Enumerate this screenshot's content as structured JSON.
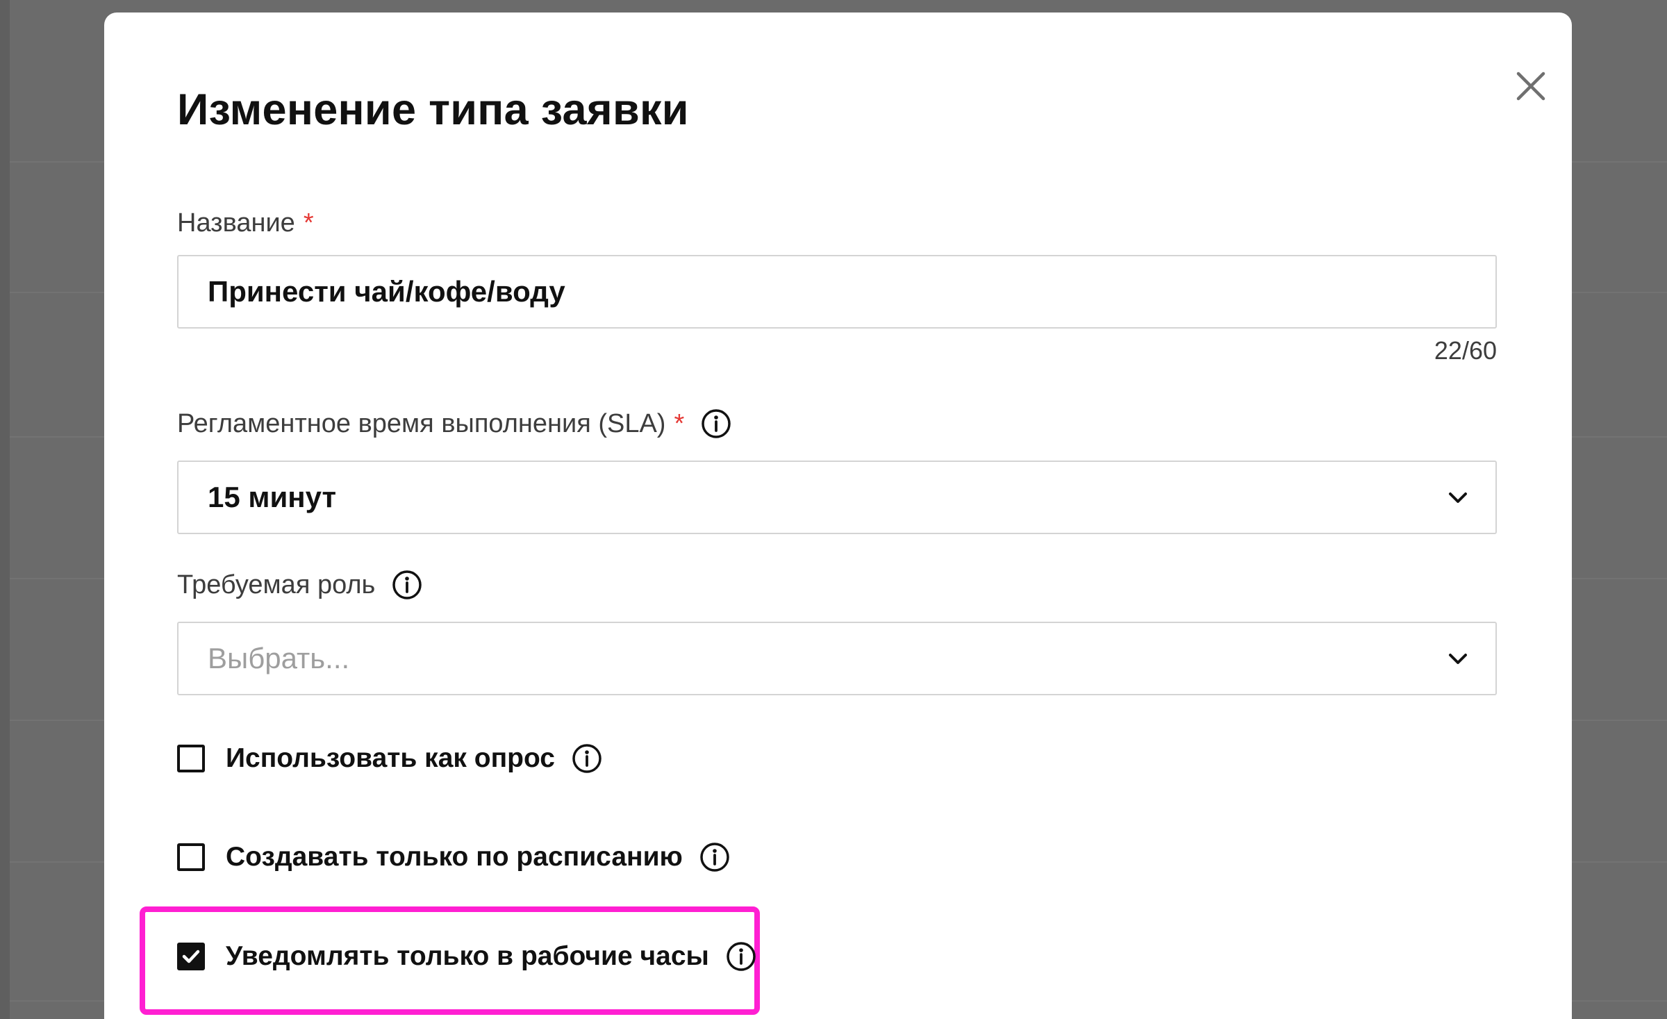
{
  "dialog": {
    "title": "Изменение типа заявки",
    "close_icon": "close-icon"
  },
  "name_field": {
    "label": "Название",
    "required_mark": "*",
    "value": "Принести чай/кофе/воду",
    "counter": "22/60"
  },
  "sla_field": {
    "label": "Регламентное время выполнения (SLA)",
    "required_mark": "*",
    "info_icon": "info-icon",
    "value": "15 минут",
    "dropdown_icon": "chevron-down-icon"
  },
  "role_field": {
    "label": "Требуемая роль",
    "info_icon": "info-icon",
    "placeholder": "Выбрать...",
    "dropdown_icon": "chevron-down-icon"
  },
  "checkboxes": [
    {
      "label": "Использовать как опрос",
      "checked": false,
      "info_icon": "info-icon"
    },
    {
      "label": "Создавать только по расписанию",
      "checked": false,
      "info_icon": "info-icon"
    },
    {
      "label": "Уведомлять только в рабочие часы",
      "checked": true,
      "info_icon": "info-icon"
    }
  ],
  "colors": {
    "highlight": "#ff1fd2",
    "required": "#e53935",
    "overlay": "#6b6b6b"
  }
}
